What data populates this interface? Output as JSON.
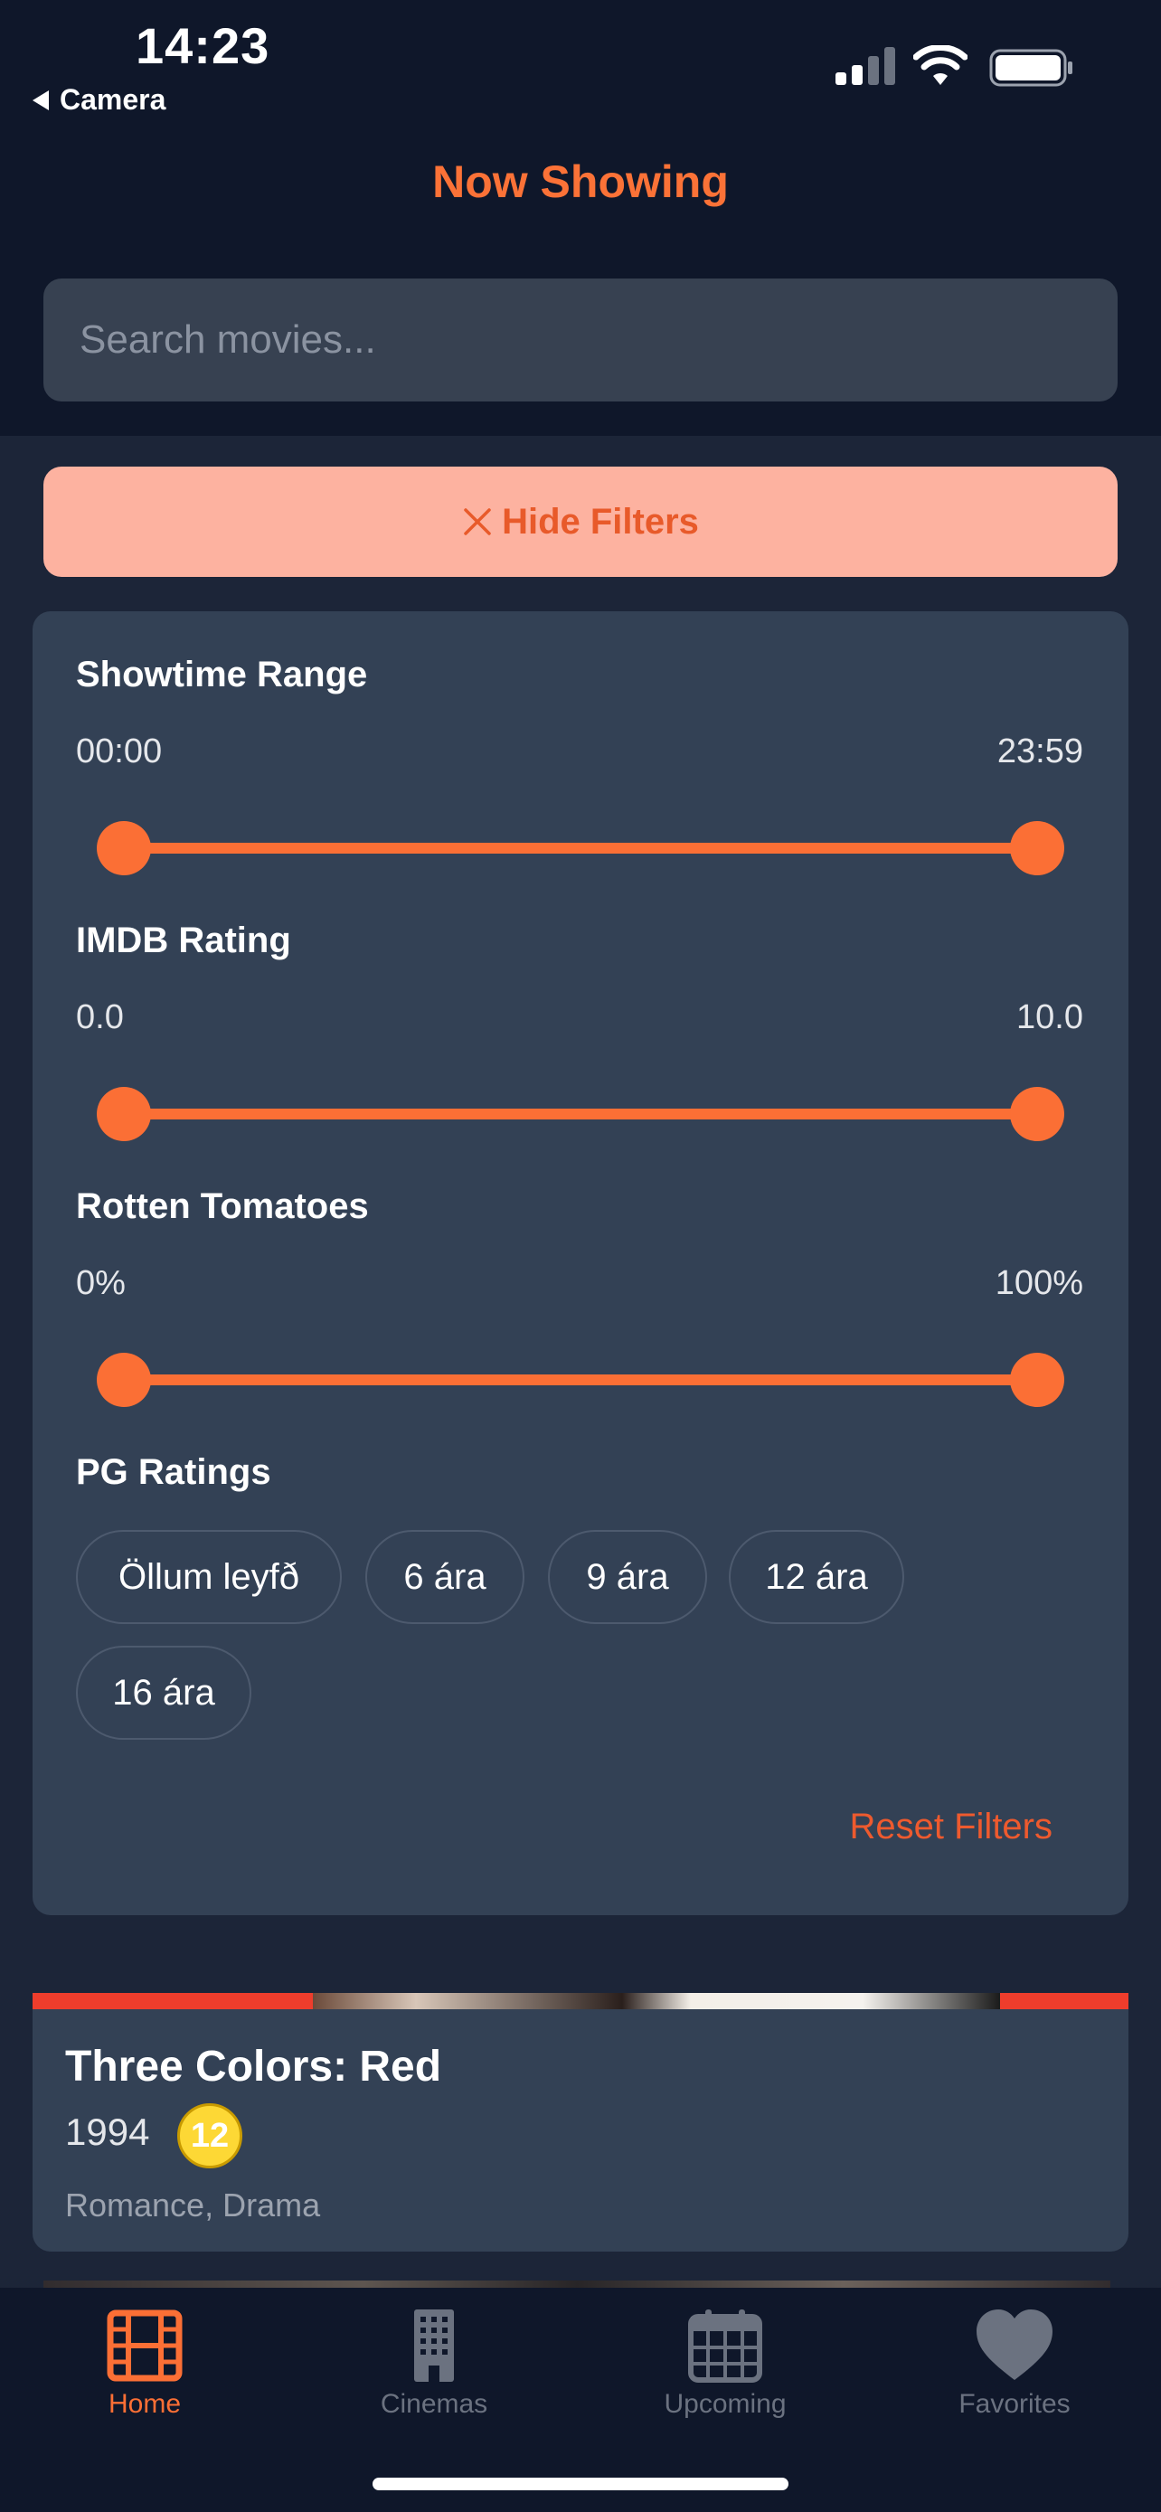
{
  "status_bar": {
    "time": "14:23",
    "back_label": "Camera"
  },
  "header": {
    "title": "Now Showing"
  },
  "search": {
    "placeholder": "Search movies..."
  },
  "filters": {
    "hide_label": "Hide Filters",
    "showtime": {
      "title": "Showtime Range",
      "min": "00:00",
      "max": "23:59"
    },
    "imdb": {
      "title": "IMDB Rating",
      "min": "0.0",
      "max": "10.0"
    },
    "rotten": {
      "title": "Rotten Tomatoes",
      "min": "0%",
      "max": "100%"
    },
    "pg": {
      "title": "PG Ratings",
      "chips": [
        "Öllum leyfð",
        "6 ára",
        "9 ára",
        "12 ára",
        "16 ára"
      ]
    },
    "reset_label": "Reset Filters"
  },
  "movie": {
    "title": "Three Colors: Red",
    "year": "1994",
    "age_rating": "12",
    "genres": "Romance, Drama"
  },
  "tabs": [
    {
      "label": "Home",
      "icon": "film-icon",
      "active": true
    },
    {
      "label": "Cinemas",
      "icon": "building-icon",
      "active": false
    },
    {
      "label": "Upcoming",
      "icon": "calendar-icon",
      "active": false
    },
    {
      "label": "Favorites",
      "icon": "heart-icon",
      "active": false
    }
  ],
  "colors": {
    "accent": "#fb6f35",
    "background": "#0f172a",
    "panel": "#334155",
    "hide_button_bg": "#fdb2a0",
    "age_badge": "#fdd835"
  }
}
